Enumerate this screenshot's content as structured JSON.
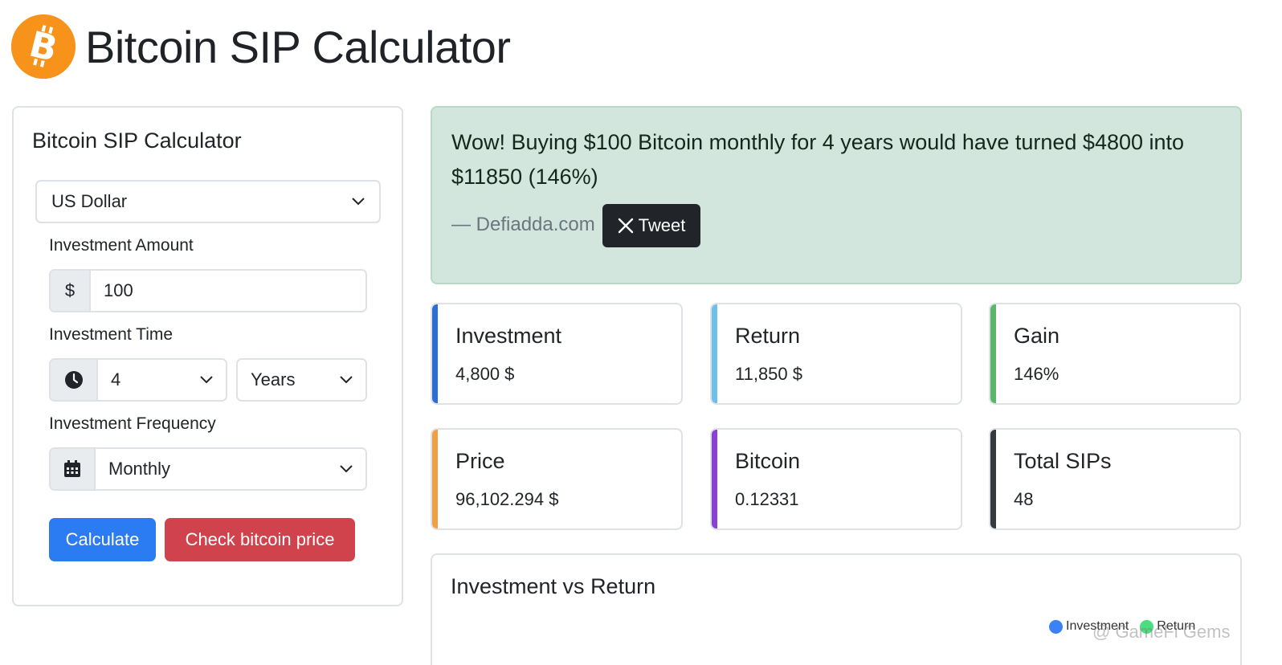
{
  "header": {
    "title": "Bitcoin SIP Calculator",
    "logo_icon": "bitcoin-logo-icon"
  },
  "form": {
    "title": "Bitcoin SIP Calculator",
    "currency": "US Dollar",
    "amount_label": "Investment Amount",
    "currency_symbol": "$",
    "amount_value": "100",
    "time_label": "Investment Time",
    "time_value": "4",
    "time_unit": "Years",
    "frequency_label": "Investment Frequency",
    "frequency_value": "Monthly",
    "calculate_label": "Calculate",
    "check_price_label": "Check bitcoin price"
  },
  "alert": {
    "message": "Wow! Buying $100 Bitcoin monthly for 4 years would have turned $4800 into $11850 (146%)",
    "source": "— Defiadda.com",
    "tweet_label": "Tweet"
  },
  "stats": [
    {
      "title": "Investment",
      "value": "4,800 $",
      "color": "#2b6fd6"
    },
    {
      "title": "Return",
      "value": "11,850 $",
      "color": "#6ec0ea"
    },
    {
      "title": "Gain",
      "value": "146%",
      "color": "#5cb66a"
    },
    {
      "title": "Price",
      "value": "96,102.294 $",
      "color": "#f0a043"
    },
    {
      "title": "Bitcoin",
      "value": "0.12331",
      "color": "#8b3fd3"
    },
    {
      "title": "Total SIPs",
      "value": "48",
      "color": "#343a40"
    }
  ],
  "chart": {
    "title": "Investment vs Return",
    "legend": [
      {
        "name": "Investment",
        "color": "#3b82f6"
      },
      {
        "name": "Return",
        "color": "#4ade80"
      }
    ]
  },
  "colors": {
    "primary": "#2b7bf3",
    "danger": "#d1434c",
    "bitcoin": "#f7931a",
    "alert_bg": "#d3e6dd"
  },
  "watermark": "@ GameFi Gems"
}
